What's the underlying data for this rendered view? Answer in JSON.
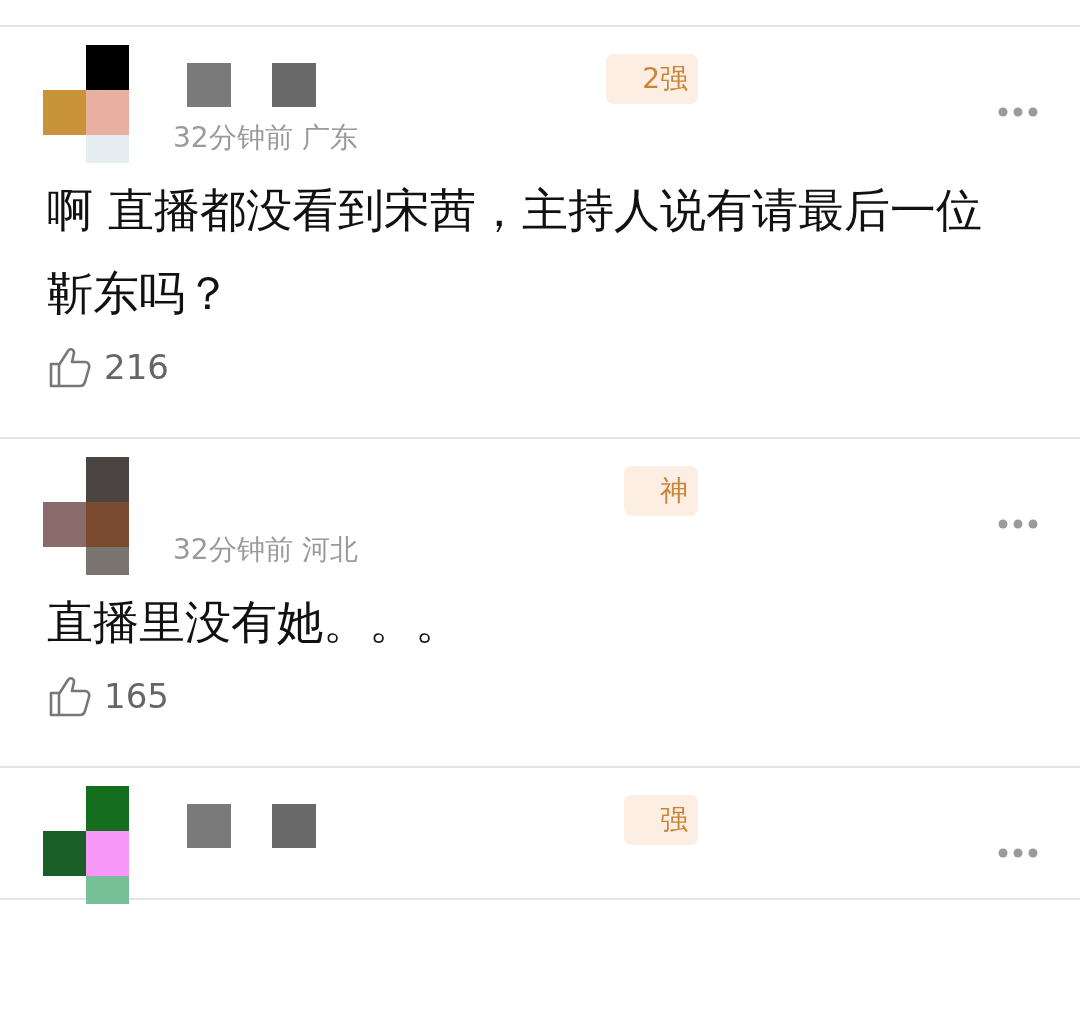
{
  "comments": [
    {
      "badge": "2强",
      "meta": "32分钟前 广东",
      "text": "啊 直播都没看到宋茜，主持人说有请最后一位靳东吗？",
      "likes": "216"
    },
    {
      "badge": "神",
      "meta": "32分钟前 河北",
      "text": "直播里没有她。。。",
      "likes": "165"
    },
    {
      "badge": "强"
    }
  ]
}
